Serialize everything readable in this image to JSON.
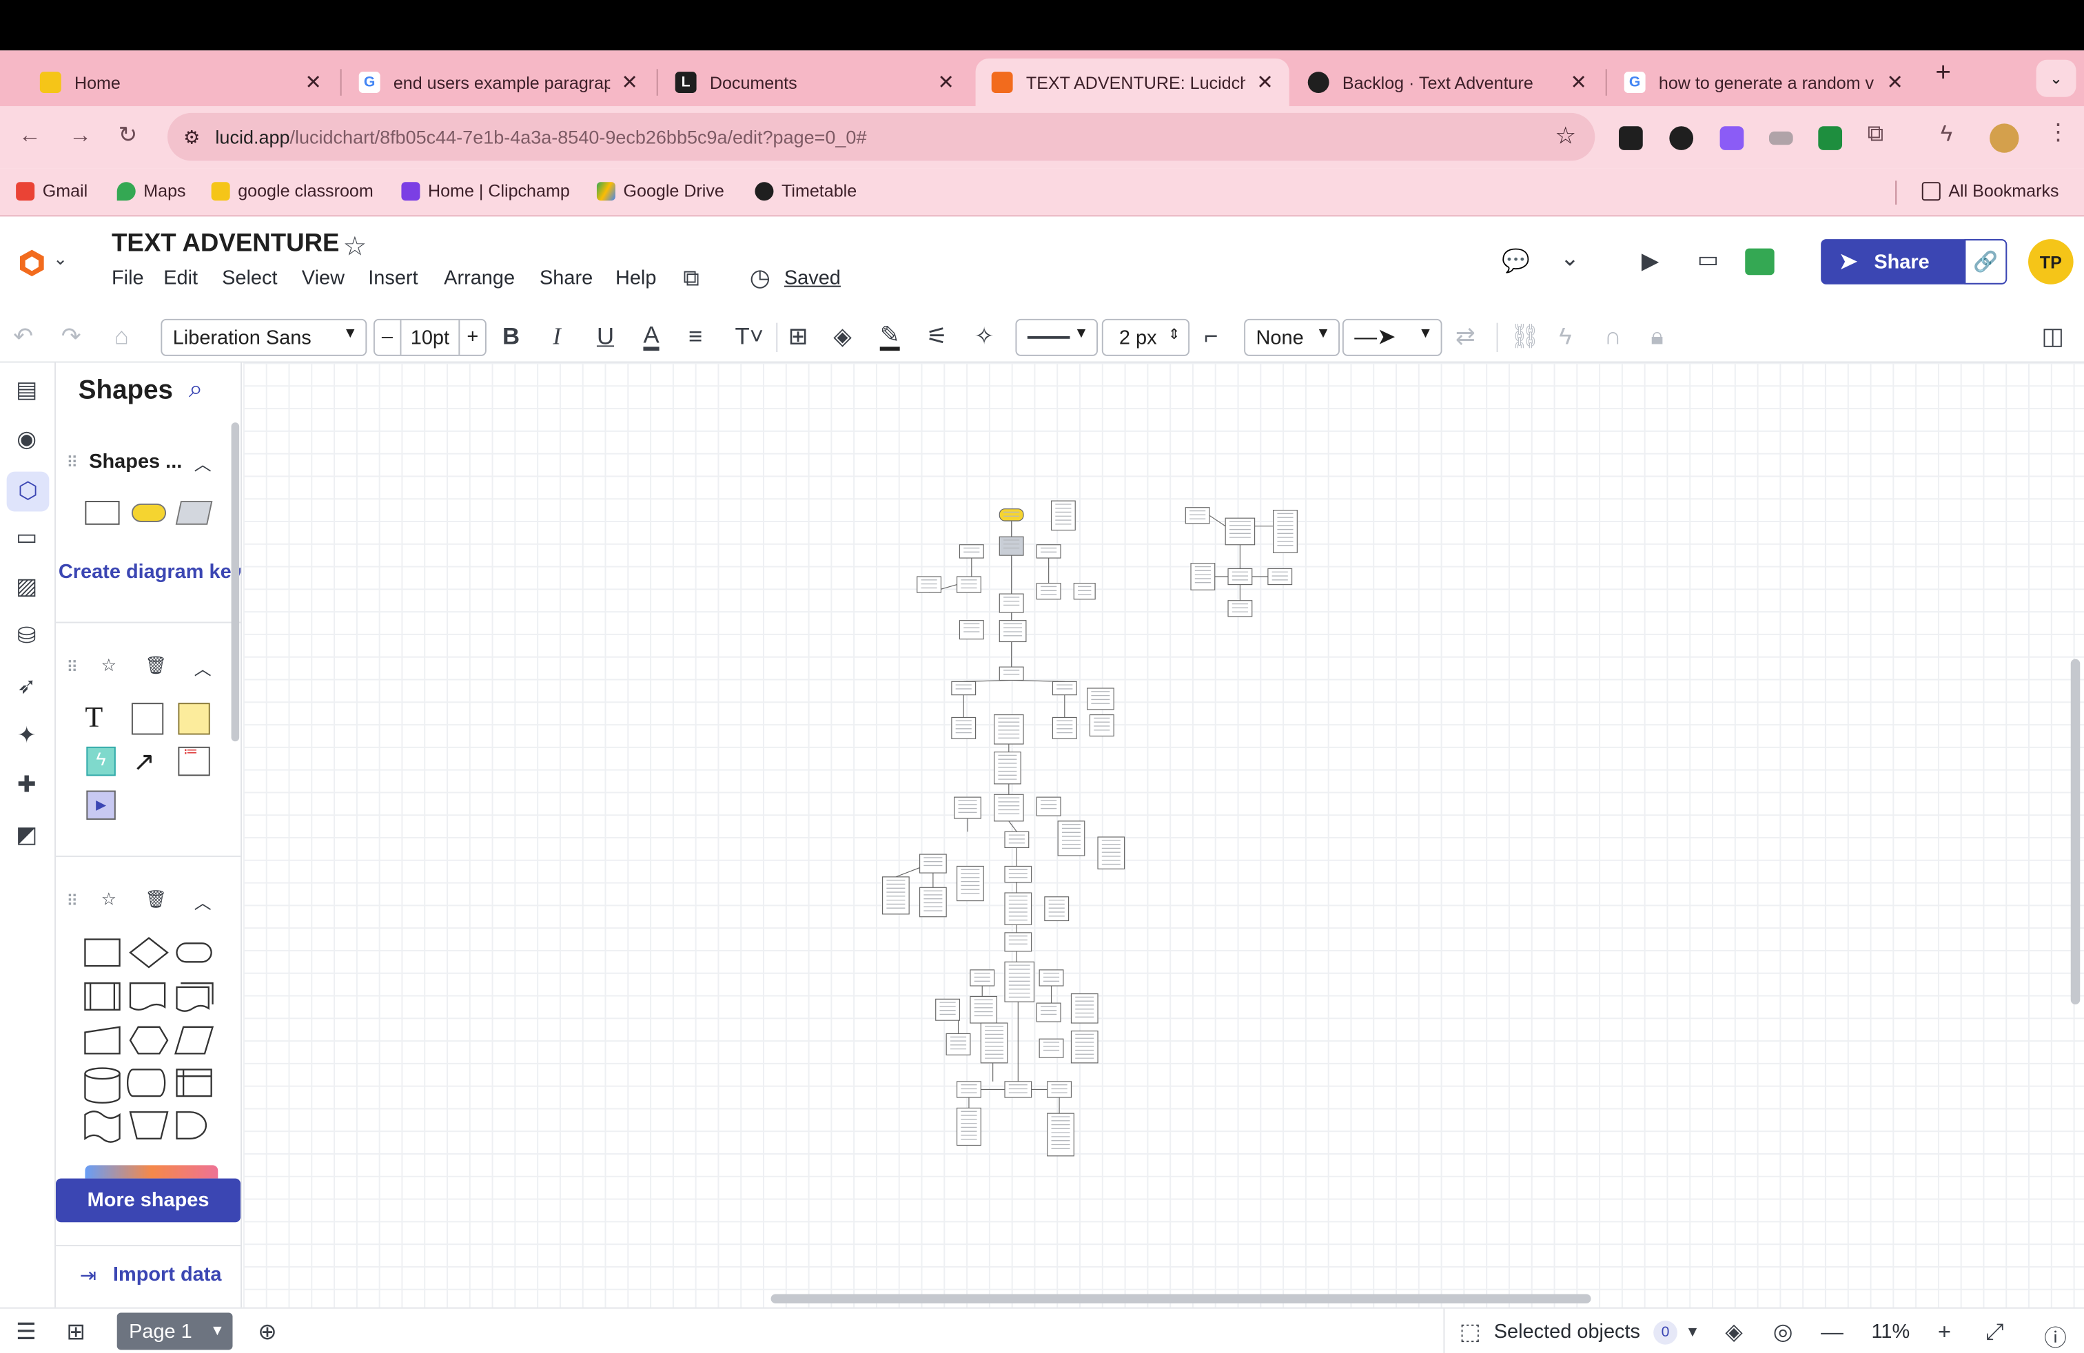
{
  "browser": {
    "tabs": [
      {
        "label": "Home",
        "favicon_color": "#f5c518"
      },
      {
        "label": "end users example paragrap",
        "favicon_color": "#ffffff"
      },
      {
        "label": "Documents",
        "favicon_color": "#1f1f1f"
      },
      {
        "label": "TEXT ADVENTURE: Lucidch",
        "favicon_color": "#f26b1d"
      },
      {
        "label": "Backlog · Text Adventure",
        "favicon_color": "#1f1f1f"
      },
      {
        "label": "how to generate a random v",
        "favicon_color": "#ffffff"
      }
    ],
    "url_host": "lucid.app",
    "url_path": "/lucidchart/8fb05c44-7e1b-4a3a-8540-9ecb26bb5c9a/edit?page=0_0#",
    "bookmarks": [
      "Gmail",
      "Maps",
      "google classroom",
      "Home | Clipchamp",
      "Google Drive",
      "Timetable"
    ],
    "all_bookmarks_label": "All Bookmarks"
  },
  "app": {
    "doc_title": "TEXT ADVENTURE",
    "menu": [
      "File",
      "Edit",
      "Select",
      "View",
      "Insert",
      "Arrange",
      "Share",
      "Help"
    ],
    "saved_label": "Saved",
    "share_label": "Share",
    "avatar_initials": "TP",
    "accent": "#3b46b3"
  },
  "toolbar": {
    "font_family": "Liberation Sans",
    "font_size": "10pt",
    "line_width": "2 px",
    "line_start": "None"
  },
  "panel": {
    "title": "Shapes",
    "section_title": "Shapes ...",
    "diagram_key_label": "Create diagram key",
    "more_shapes_label": "More shapes",
    "import_label": "Import data"
  },
  "bottom": {
    "page_label": "Page 1",
    "selected_label": "Selected objects",
    "selected_count": "0",
    "zoom": "11%"
  }
}
